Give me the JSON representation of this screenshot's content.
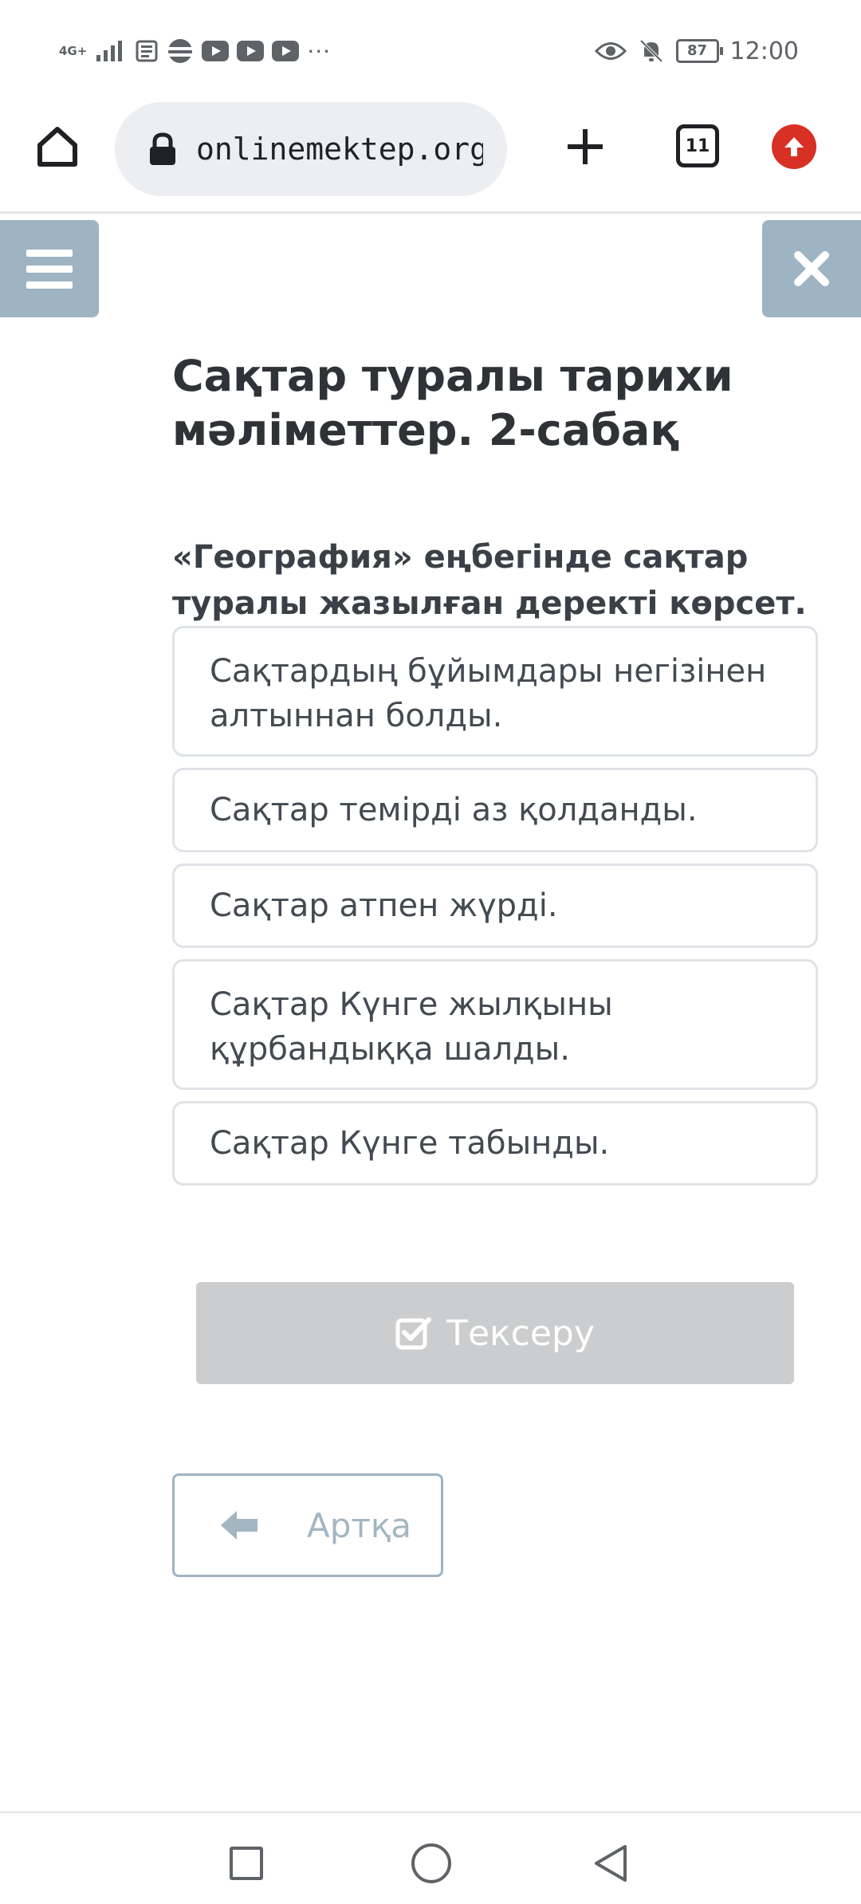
{
  "status_bar": {
    "network": "4G+",
    "battery": "87",
    "time": "12:00",
    "icons": [
      "signal-icon",
      "news-icon",
      "app-icon",
      "youtube-icon",
      "youtube-icon",
      "youtube-icon",
      "more-dots-icon",
      "eye-icon",
      "mute-bell-icon",
      "battery-icon"
    ],
    "more": "···"
  },
  "browser": {
    "url": "onlinemektep.org/s",
    "tab_count": "11",
    "icons": [
      "home-icon",
      "lock-icon",
      "plus-icon",
      "tabs-icon",
      "update-icon"
    ],
    "accent_update": "#d93025"
  },
  "toolbar": {
    "menu_icon": "hamburger-icon",
    "close_icon": "close-icon",
    "button_color": "#9fb4c2"
  },
  "lesson": {
    "title": "Сақтар туралы тарихи мәліметтер. 2-сабақ",
    "question": "«География» еңбегінде сақтар туралы жазылған деректі көрсет.",
    "options": [
      "Сақтардың бұйымдары негізінен алтыннан болды.",
      "Сақтар темірді аз қолданды.",
      "Сақтар атпен жүрді.",
      "Сақтар Күнге жылқыны құрбандыққа шалды.",
      "Сақтар Күнге табынды."
    ]
  },
  "actions": {
    "check_label": "Тексеру",
    "check_icon": "checkbox-icon",
    "back_label": "Артқа",
    "back_icon": "arrow-left-icon"
  },
  "nav": {
    "icons": [
      "recent-apps-icon",
      "home-circle-icon",
      "back-triangle-icon"
    ]
  }
}
